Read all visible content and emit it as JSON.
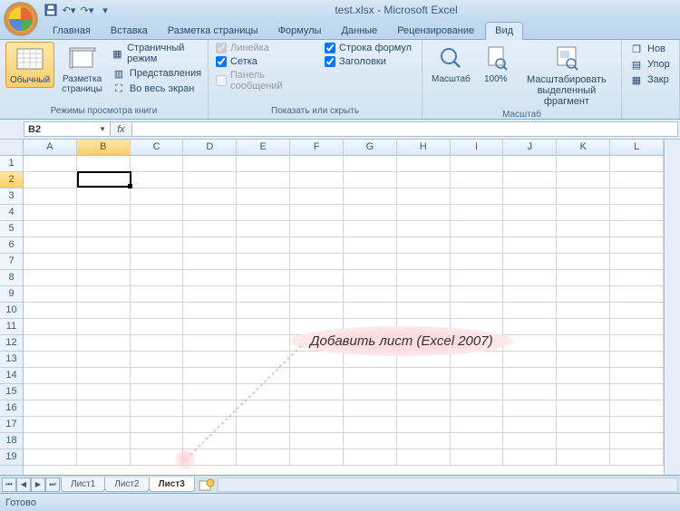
{
  "title": "test.xlsx - Microsoft Excel",
  "tabs": [
    "Главная",
    "Вставка",
    "Разметка страницы",
    "Формулы",
    "Данные",
    "Рецензирование",
    "Вид"
  ],
  "active_tab": 6,
  "ribbon": {
    "views": {
      "normal": "Обычный",
      "layout": "Разметка страницы",
      "page_break": "Страничный режим",
      "custom_views": "Представления",
      "full_screen": "Во весь экран",
      "group_label": "Режимы просмотра книги"
    },
    "show": {
      "ruler": "Линейка",
      "gridlines": "Сетка",
      "message_bar": "Панель сообщений",
      "formula_bar": "Строка формул",
      "headings": "Заголовки",
      "group_label": "Показать или скрыть"
    },
    "zoom": {
      "zoom": "Масштаб",
      "hundred": "100%",
      "to_selection_l1": "Масштабировать",
      "to_selection_l2": "выделенный фрагмент",
      "group_label": "Масштаб"
    },
    "window": {
      "new": "Нов",
      "arrange": "Упор",
      "freeze": "Закр"
    }
  },
  "namebox": "B2",
  "columns": [
    "A",
    "B",
    "C",
    "D",
    "E",
    "F",
    "G",
    "H",
    "I",
    "J",
    "K",
    "L"
  ],
  "rows": 19,
  "selected": {
    "col": 1,
    "row": 1
  },
  "sheets": [
    "Лист1",
    "Лист2",
    "Лист3"
  ],
  "active_sheet": 2,
  "annotation": "Добавить лист (Excel 2007)",
  "status": "Готово"
}
